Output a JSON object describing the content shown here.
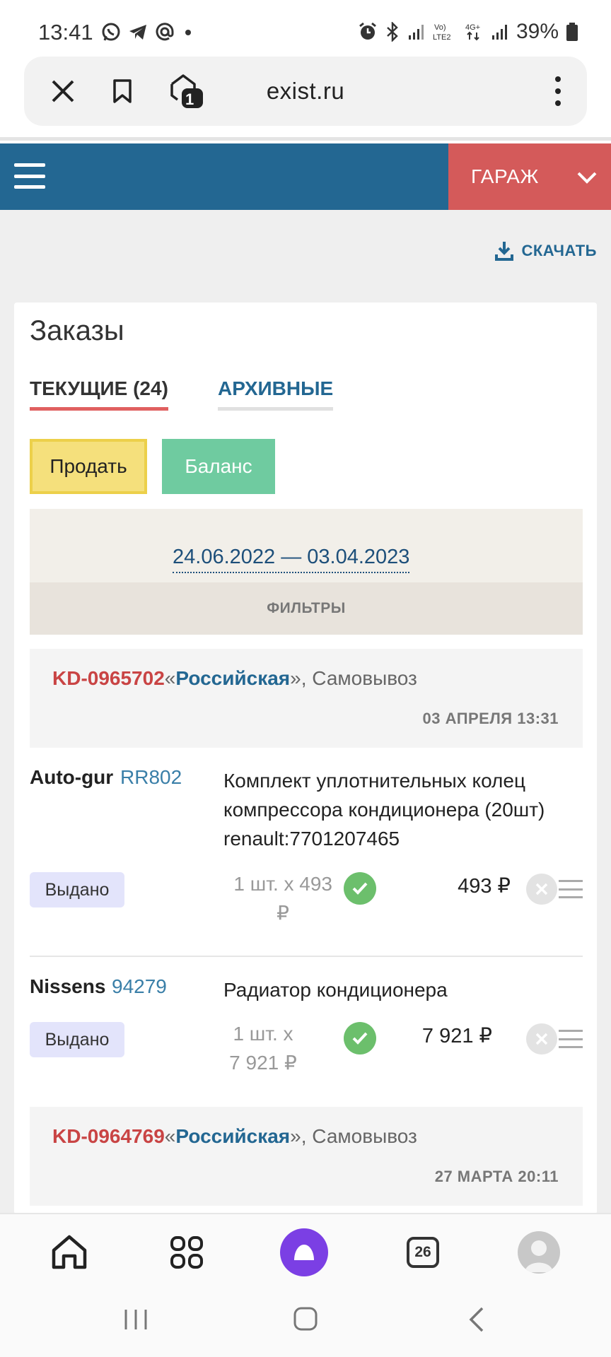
{
  "status_bar": {
    "time": "13:41",
    "battery": "39%",
    "left_icons": [
      "whatsapp-icon",
      "telegram-icon",
      "at-icon",
      "dot-icon"
    ],
    "right_icons": [
      "alarm-icon",
      "bluetooth-icon",
      "signal-icon",
      "volte-icon",
      "4g-icon",
      "signal-icon",
      "battery-icon"
    ]
  },
  "browser": {
    "url": "exist.ru",
    "tabs_count": "1"
  },
  "site_header": {
    "garage_label": "ГАРАЖ"
  },
  "toolbar": {
    "download_label": "СКАЧАТЬ"
  },
  "orders": {
    "title": "Заказы",
    "tab_current": "ТЕКУЩИЕ (24)",
    "tab_archive": "АРХИВНЫЕ",
    "sell_button": "Продать",
    "balance_button": "Баланс",
    "date_range": "24.06.2022 — 03.04.2023",
    "filters_label": "ФИЛЬТРЫ",
    "list": [
      {
        "id": "KD-0965702",
        "shop": "Российская",
        "quote_open": "«",
        "quote_close": "»",
        "delivery": ", Самовывоз",
        "date": "03 АПРЕЛЯ 13:31",
        "items": [
          {
            "brand": "Auto-gur",
            "article": "RR802",
            "description": "Комплект уплотнительных колец компрессора кондиционера (20шт) renault:7701207465",
            "status": "Выдано",
            "qty_line1": "1 шт. x 493",
            "qty_line2": "₽",
            "price": "493 ₽"
          },
          {
            "brand": "Nissens",
            "article": "94279",
            "description": "Радиатор кондиционера",
            "status": "Выдано",
            "qty_line1": "1 шт. x",
            "qty_line2": "7 921 ₽",
            "price": "7 921 ₽"
          }
        ]
      },
      {
        "id": "KD-0964769",
        "shop": "Российская",
        "quote_open": "«",
        "quote_close": "»",
        "delivery": ", Самовывоз",
        "date": "27 МАРТА 20:11"
      }
    ]
  },
  "bottom_nav": {
    "calendar_day": "26",
    "items": [
      "home-icon",
      "apps-icon",
      "alice-icon",
      "calendar-icon",
      "profile-avatar"
    ]
  },
  "colors": {
    "header_blue": "#236792",
    "garage_red": "#d45a5a",
    "order_id_red": "#c94444",
    "sell_yellow": "#f5e07c",
    "balance_green": "#6fcba0",
    "status_badge": "#e3e4fb",
    "alice_purple": "#7b3fe4"
  }
}
